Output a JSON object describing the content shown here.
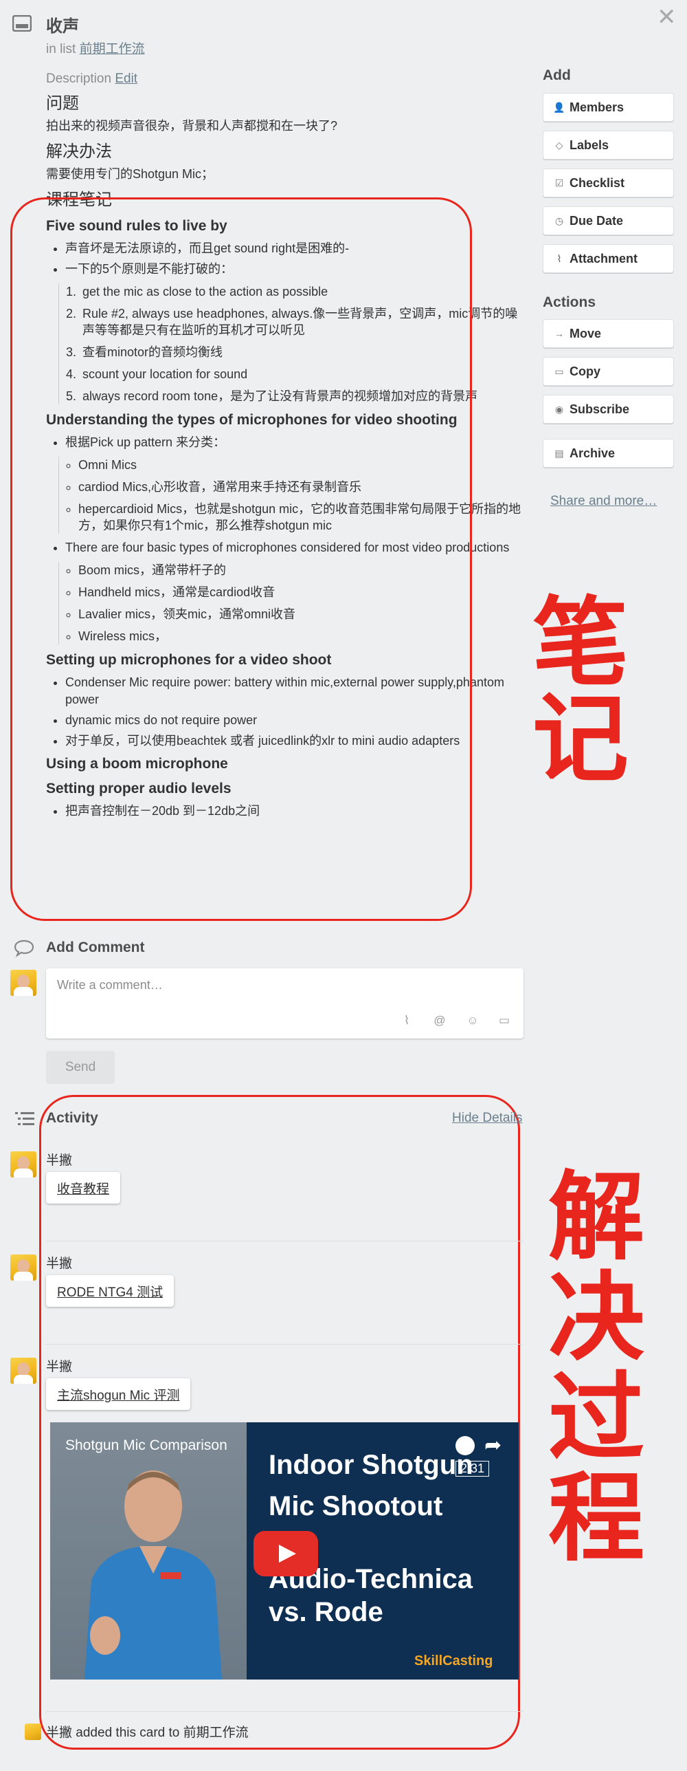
{
  "card": {
    "title": "收声",
    "in_list_prefix": "in list",
    "list_name": "前期工作流"
  },
  "description": {
    "label": "Description",
    "edit": "Edit",
    "problem_heading": "问题",
    "problem_text": "拍出来的视频声音很杂，背景和人声都搅和在一块了?",
    "solution_heading": "解决办法",
    "solution_text": "需要使用专门的Shotgun Mic；",
    "notes_heading": "课程笔记",
    "s1_heading": "Five sound rules to live by",
    "s1_bullets": [
      "声音坏是无法原谅的，而且get sound right是困难的-",
      "一下的5个原则是不能打破的："
    ],
    "s1_rules": [
      "get the mic as close to the action as possible",
      "Rule #2, always use headphones, always.像一些背景声，空调声，mic调节的噪声等等都是只有在监听的耳机才可以听见",
      "查看minotor的音频均衡线",
      "scount your location for sound",
      "always record room tone，是为了让没有背景声的视频增加对应的背景声"
    ],
    "s2_heading": "Understanding the types of microphones for video shooting",
    "s2_bullet1": "根据Pick up pattern 来分类：",
    "s2_patterns": [
      "Omni Mics",
      "cardiod Mics,心形收音，通常用来手持还有录制音乐",
      "hepercardioid Mics，也就是shotgun mic，它的收音范围非常句局限于它所指的地方，如果你只有1个mic，那么推荐shotgun mic"
    ],
    "s2_bullet2": "There are four basic types of microphones considered for most video productions",
    "s2_types": [
      "Boom mics，通常带杆子的",
      "Handheld mics，通常是cardiod收音",
      "Lavalier mics，领夹mic，通常omni收音",
      "Wireless mics，"
    ],
    "s3_heading": "Setting up microphones for a video shoot",
    "s3_bullets": [
      "Condenser Mic require power: battery within mic,external power supply,phantom power",
      "dynamic mics do not require power",
      "对于单反，可以使用beachtek 或者 juicedlink的xlr to mini audio adapters"
    ],
    "s4_heading": "Using a boom microphone",
    "s5_heading": "Setting proper audio levels",
    "s5_bullets": [
      "把声音控制在－20db 到－12db之间"
    ]
  },
  "sidebar": {
    "add_label": "Add",
    "add_buttons": [
      "Members",
      "Labels",
      "Checklist",
      "Due Date",
      "Attachment"
    ],
    "actions_label": "Actions",
    "action_buttons": [
      "Move",
      "Copy",
      "Subscribe",
      "Archive"
    ],
    "share": "Share and more…"
  },
  "annotations": {
    "notes": "笔记",
    "process": "解决过程"
  },
  "comment": {
    "heading": "Add Comment",
    "placeholder": "Write a comment…",
    "send": "Send"
  },
  "activity": {
    "heading": "Activity",
    "hide_details": "Hide Details",
    "items": [
      {
        "author": "半撇",
        "attachment": "收音教程"
      },
      {
        "author": "半撇",
        "attachment": "RODE NTG4 测试"
      },
      {
        "author": "半撇",
        "attachment": "主流shogun Mic 评测"
      }
    ],
    "video": {
      "title": "Shotgun Mic Comparison",
      "headline1": "Indoor Shotgun",
      "headline2": "Mic Shootout",
      "headline3": "Audio-Technica",
      "headline4": "vs. Rode",
      "brand": "SkillCasting",
      "time": "2:31"
    },
    "footer_author": "半撇",
    "footer_text": "added this card to 前期工作流"
  },
  "colors": {
    "accent_red": "#e8261d",
    "link_gray": "#6b808c"
  }
}
